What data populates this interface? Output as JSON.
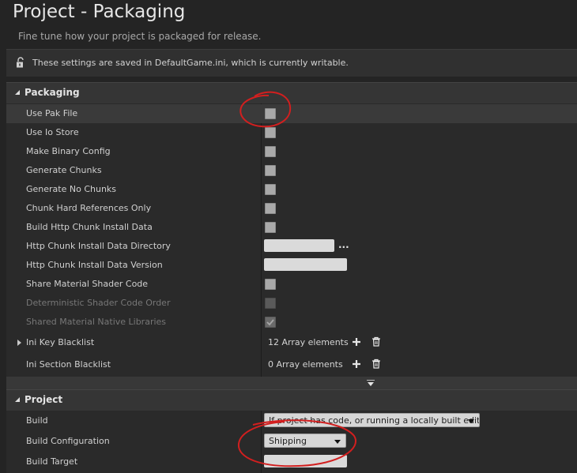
{
  "header": {
    "title": "Project - Packaging",
    "subtitle": "Fine tune how your project is packaged for release."
  },
  "notice": {
    "icon": "unlocked-padlock-icon",
    "text": "These settings are saved in DefaultGame.ini, which is currently writable."
  },
  "packaging": {
    "label": "Packaging",
    "rows": [
      {
        "label": "Use Pak File",
        "control": "checkbox",
        "checked": false
      },
      {
        "label": "Use Io Store",
        "control": "checkbox",
        "checked": false
      },
      {
        "label": "Make Binary Config",
        "control": "checkbox",
        "checked": false
      },
      {
        "label": "Generate Chunks",
        "control": "checkbox",
        "checked": false
      },
      {
        "label": "Generate No Chunks",
        "control": "checkbox",
        "checked": false
      },
      {
        "label": "Chunk Hard References Only",
        "control": "checkbox",
        "checked": false
      },
      {
        "label": "Build Http Chunk Install Data",
        "control": "checkbox",
        "checked": false
      },
      {
        "label": "Http Chunk Install Data Directory",
        "control": "text-browse",
        "value": ""
      },
      {
        "label": "Http Chunk Install Data Version",
        "control": "text",
        "value": ""
      },
      {
        "label": "Share Material Shader Code",
        "control": "checkbox",
        "checked": false
      },
      {
        "label": "Deterministic Shader Code Order",
        "control": "checkbox",
        "checked": false,
        "disabled": true
      },
      {
        "label": "Shared Material Native Libraries",
        "control": "checkbox",
        "checked": true,
        "disabled": true
      },
      {
        "label": "Ini Key Blacklist",
        "control": "array",
        "value": "12 Array elements"
      },
      {
        "label": "Ini Section Blacklist",
        "control": "array",
        "value": "0 Array elements"
      }
    ]
  },
  "project": {
    "label": "Project",
    "rows": [
      {
        "label": "Build",
        "control": "combo",
        "value": "If project has code, or running a locally built editor"
      },
      {
        "label": "Build Configuration",
        "control": "combo",
        "value": "Shipping"
      },
      {
        "label": "Build Target",
        "control": "text",
        "value": ""
      }
    ]
  },
  "browse_label": "...",
  "colors": {
    "background": "#242424",
    "annotation": "#d21f1f"
  }
}
